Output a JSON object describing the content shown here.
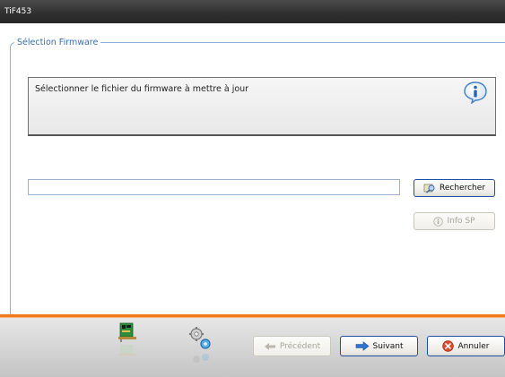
{
  "window": {
    "title": "TiF453"
  },
  "section": {
    "legend": "Sélection Firmware"
  },
  "infobox": {
    "text": "Sélectionner le fichier du firmware à mettre à jour",
    "icon": "info-icon"
  },
  "file": {
    "value": "",
    "browse_label": "Rechercher",
    "browse_icon": "search-folder-icon"
  },
  "infosp": {
    "label": "Info SP",
    "icon": "info-icon"
  },
  "footer": {
    "icons": [
      "network-card-icon",
      "gear-settings-icon"
    ],
    "prev_label": "Précédent",
    "next_label": "Suivant",
    "cancel_label": "Annuler"
  },
  "colors": {
    "accent_orange": "#f07a1d",
    "title_bg": "#2f2f2f",
    "legend_blue": "#3a6fb0"
  }
}
